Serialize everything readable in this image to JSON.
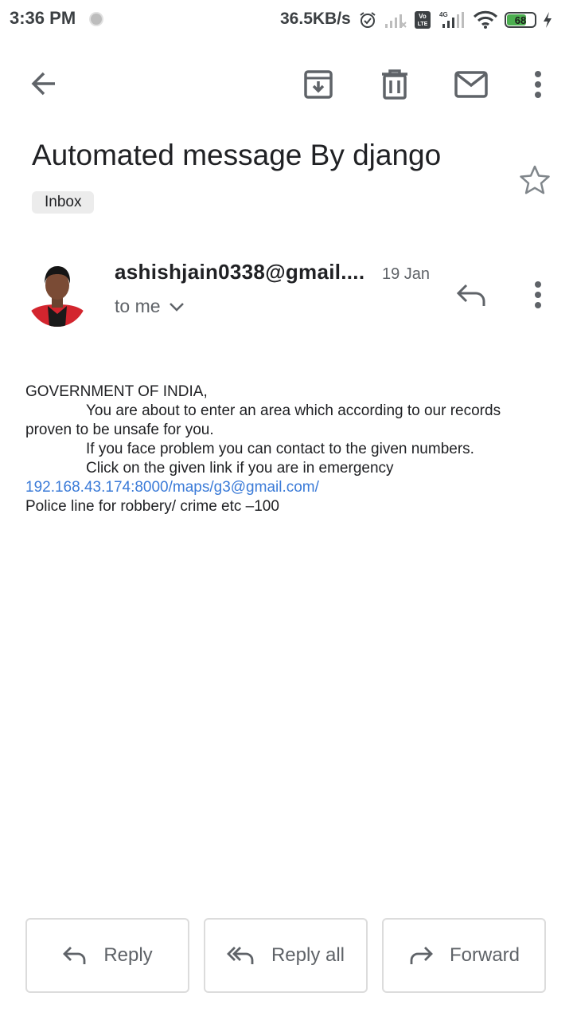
{
  "status_bar": {
    "time": "3:36 PM",
    "speed": "36.5KB/s",
    "battery": "68"
  },
  "subject": "Automated message By django",
  "label": "Inbox",
  "sender": {
    "email": "ashishjain0338@gmail....",
    "date": "19 Jan",
    "recipient": "to me"
  },
  "body": {
    "lines": [
      "GOVERNMENT OF INDIA,",
      "You are about to enter an area which according to our records",
      "proven to be unsafe for you.",
      "If you face problem you can contact to the given numbers.",
      "Click on the given link if you are in emergency",
      "192.168.43.174:8000/maps/g3@gmail.com/",
      "Police line for robbery/ crime etc –100"
    ]
  },
  "actions": {
    "reply": "Reply",
    "reply_all": "Reply all",
    "forward": "Forward"
  },
  "colors": {
    "link": "#3b7bd8",
    "icon": "#5f6368",
    "battery": "#4caf50"
  }
}
